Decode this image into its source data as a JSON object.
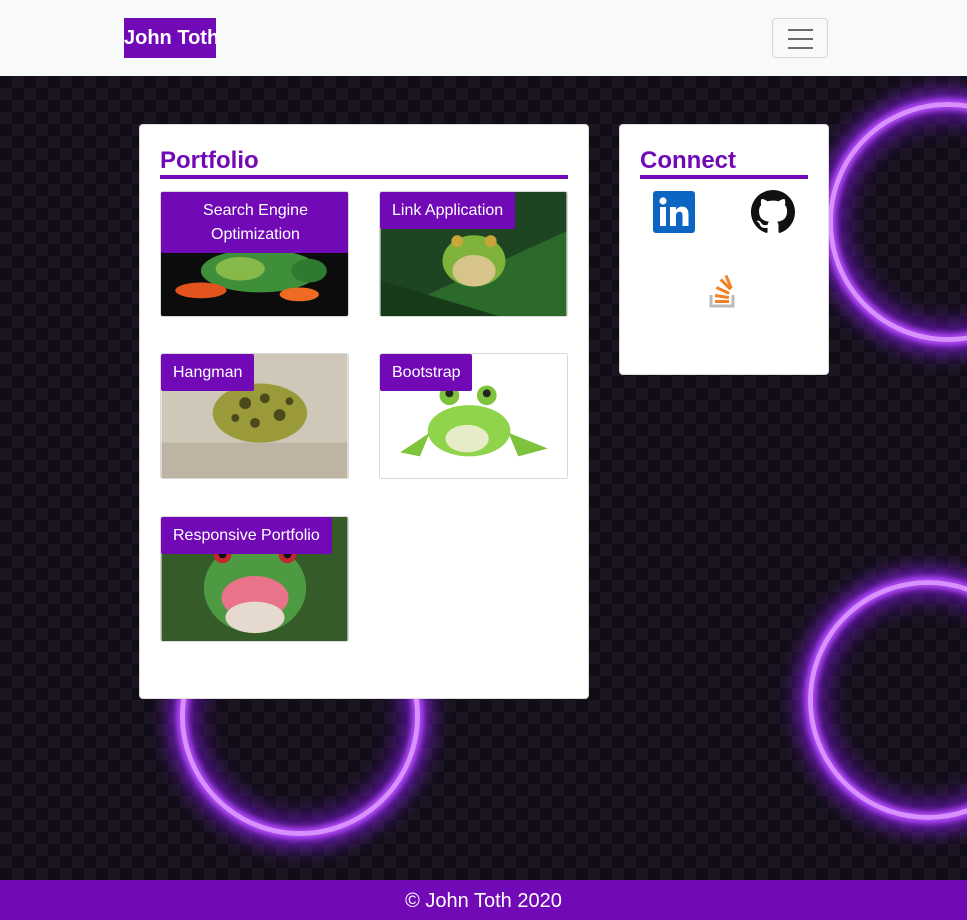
{
  "navbar": {
    "brand": "John Toth",
    "toggler_icon": "hamburger-icon"
  },
  "portfolio": {
    "title": "Portfolio",
    "projects": [
      {
        "label": "Search Engine Optimization",
        "image": "frog-orange-feet"
      },
      {
        "label": "Link Application",
        "image": "frog-on-leaf"
      },
      {
        "label": "Hangman",
        "image": "spotted-toad"
      },
      {
        "label": "Bootstrap",
        "image": "glass-frog"
      },
      {
        "label": "Responsive Portfolio",
        "image": "laughing-tree-frog"
      }
    ]
  },
  "connect": {
    "title": "Connect",
    "links": [
      {
        "icon": "linkedin-icon"
      },
      {
        "icon": "github-icon"
      },
      {
        "icon": "stackoverflow-icon"
      }
    ]
  },
  "footer": {
    "text": "© John Toth 2020"
  },
  "colors": {
    "accent": "#7209b7",
    "navbar_bg": "#f8f9fa",
    "page_bg": "#110d17"
  }
}
